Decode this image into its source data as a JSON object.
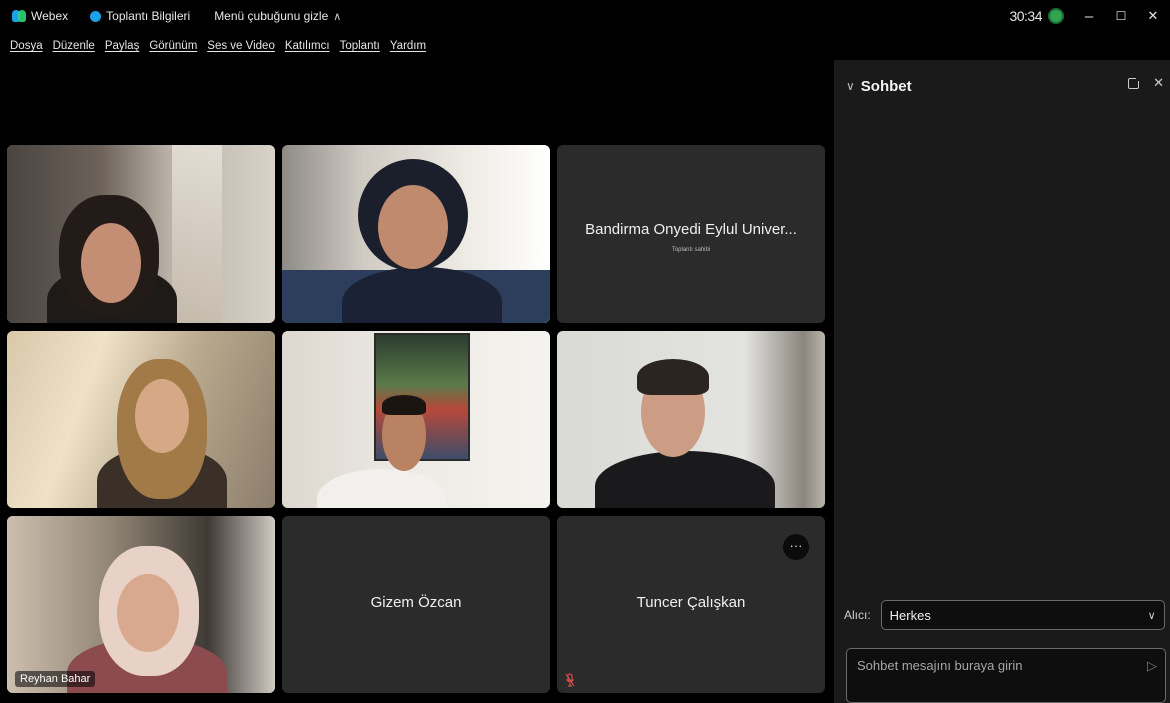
{
  "titlebar": {
    "app_name": "Webex",
    "meeting_info": "Toplantı Bilgileri",
    "hide_menu": "Menü çubuğunu gizle",
    "timer": "30:34",
    "minimize": "–",
    "maximize": "☐",
    "close": "✕"
  },
  "menu": [
    "Dosya",
    "Düzenle",
    "Paylaş",
    "Görünüm",
    "Ses ve Video",
    "Katılımcı",
    "Toplantı",
    "Yardım"
  ],
  "tiles": {
    "t1": {},
    "t2": {},
    "t3": {
      "name": "Bandirma Onyedi Eylul Univer...",
      "subtitle": "Toplantı sahibi"
    },
    "t4": {},
    "t5": {},
    "t6": {},
    "t7": {
      "name": "Reyhan Bahar"
    },
    "t8": {
      "name": "Gizem Özcan"
    },
    "t9": {
      "name": "Tuncer Çalışkan",
      "more": "···"
    }
  },
  "chat": {
    "title": "Sohbet",
    "to_label": "Alıcı:",
    "to_value": "Herkes",
    "placeholder": "Sohbet mesajını buraya girin"
  },
  "colors": {
    "accent": "#1ca2e8",
    "status": "#2ea44f",
    "tile_bg": "#2b2b2b",
    "panel_bg": "#1a1a1a"
  }
}
